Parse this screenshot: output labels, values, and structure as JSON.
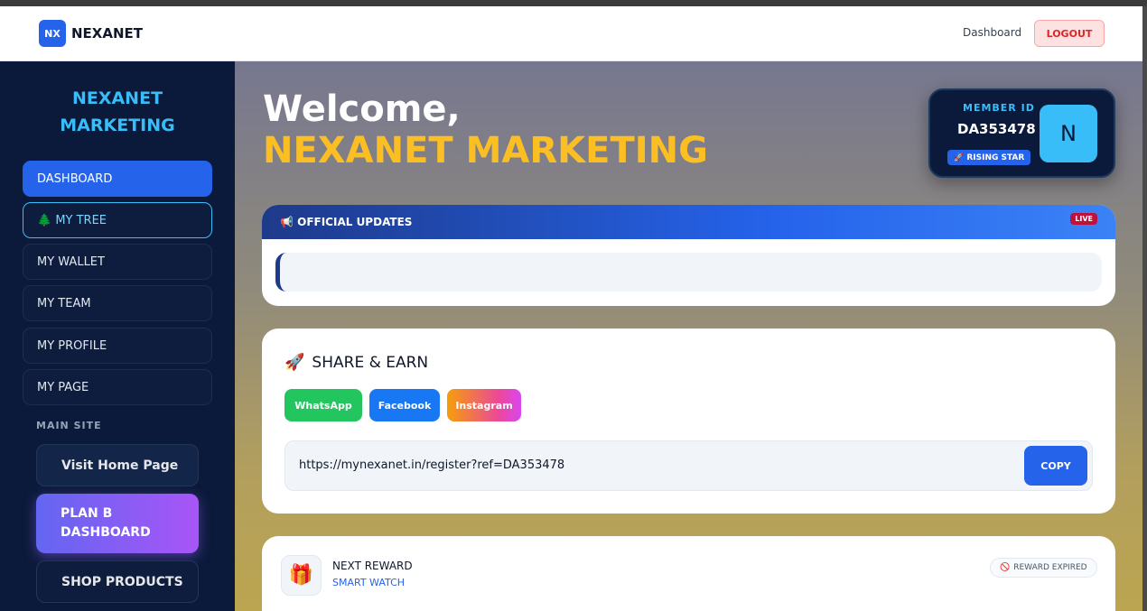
{
  "header": {
    "logo_text": "NX",
    "brand": "NEXANET",
    "dashboard_link": "Dashboard",
    "logout": "LOGOUT"
  },
  "sidebar": {
    "title_line1": "NEXANET",
    "title_line2": "MARKETING",
    "items": [
      {
        "label": "DASHBOARD"
      },
      {
        "label": "🌲 MY TREE"
      },
      {
        "label": "MY WALLET"
      },
      {
        "label": "MY TEAM"
      },
      {
        "label": "MY PROFILE"
      },
      {
        "label": "MY PAGE"
      }
    ],
    "section_label": "MAIN SITE",
    "visit_home": "Visit Home Page",
    "plan_b_line1": "PLAN B",
    "plan_b_line2": "DASHBOARD",
    "shop": "SHOP PRODUCTS"
  },
  "main": {
    "welcome": "Welcome,",
    "name": "NEXANET MARKETING",
    "member": {
      "label": "MEMBER ID",
      "id": "DA353478",
      "badge": "🚀 RISING STAR",
      "avatar_letter": "N"
    },
    "updates": {
      "title": "📢 OFFICIAL UPDATES",
      "live": "LIVE"
    },
    "share": {
      "icon": "🚀",
      "title": "SHARE & EARN",
      "whatsapp": "WhatsApp",
      "facebook": "Facebook",
      "instagram": "Instagram",
      "link": "https://mynexanet.in/register?ref=DA353478",
      "copy": "COPY"
    },
    "reward": {
      "icon": "🎁",
      "title": "NEXT REWARD",
      "subtitle": "SMART WATCH",
      "status_icon": "🚫",
      "status": "REWARD EXPIRED"
    }
  },
  "colors": {
    "accent": "#2563eb",
    "sidebar_bg": "#0b1a3a",
    "highlight": "#fbbf24",
    "cyan": "#38bdf8"
  }
}
